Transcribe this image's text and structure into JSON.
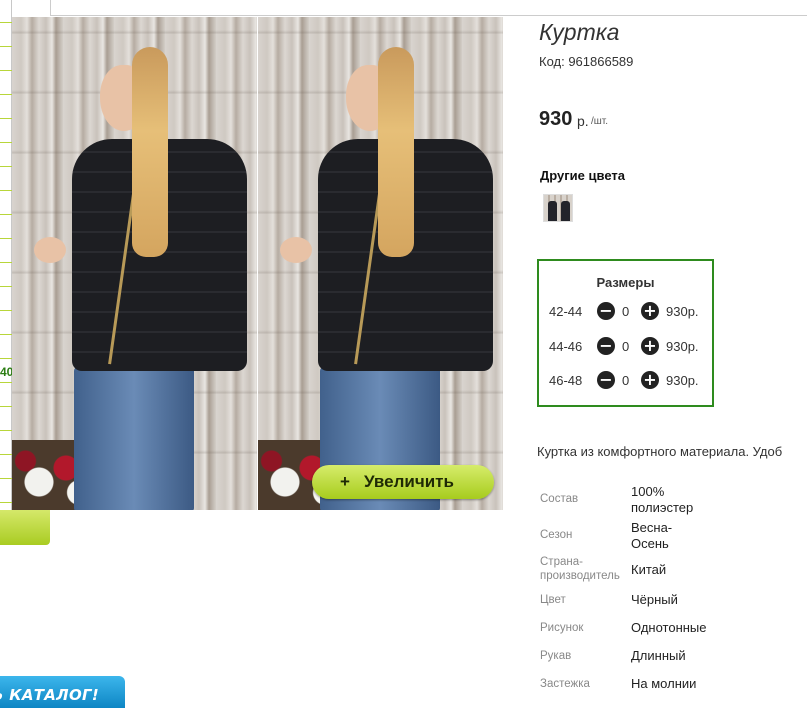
{
  "product": {
    "title": "Куртка",
    "code": "Код: 961866589",
    "price": "930",
    "currency": "р.",
    "unit": "/шт."
  },
  "zoom_button": {
    "icon": "+",
    "label": "Увеличить"
  },
  "other_colors": {
    "label": "Другие цвета"
  },
  "sizes": {
    "title": "Размеры",
    "rows": [
      {
        "size": "42-44",
        "qty": "0",
        "price": "930р."
      },
      {
        "size": "44-46",
        "qty": "0",
        "price": "930р."
      },
      {
        "size": "46-48",
        "qty": "0",
        "price": "930р."
      }
    ],
    "minus_icon": "minus-circle-icon",
    "plus_icon": "plus-circle-icon"
  },
  "description": "Куртка из комфортного материала. Удоб",
  "specs": [
    {
      "key": "Состав",
      "value": "100% полиэстер"
    },
    {
      "key": "Сезон",
      "value": "Весна-Осень"
    },
    {
      "key": "Страна-производитель",
      "value": "Китай"
    },
    {
      "key": "Цвет",
      "value": "Чёрный"
    },
    {
      "key": "Рисунок",
      "value": "Однотонные"
    },
    {
      "key": "Рукав",
      "value": "Длинный"
    },
    {
      "key": "Застежка",
      "value": "На молнии"
    }
  ],
  "left_sidebar": {
    "edge_text": "40",
    "catalog_button": "ТЬ КАТАЛОГ!"
  },
  "colors": {
    "accent_green": "#2e8b1e",
    "zoom_button_green": "#a7cc1d",
    "catalog_blue": "#0e86c4"
  }
}
